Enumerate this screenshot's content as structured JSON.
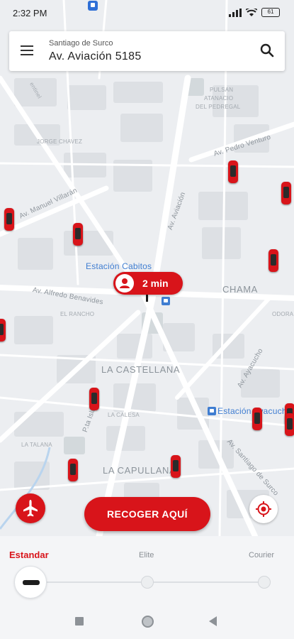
{
  "status_bar": {
    "time": "2:32 PM",
    "battery": "61"
  },
  "search": {
    "district": "Santiago de Surco",
    "address": "Av. Aviación 5185"
  },
  "map": {
    "labels": {
      "jorge_chavez": "JORGE CHAVEZ",
      "sentinel": "entinel",
      "pulsan": "PULSAN",
      "atanacio": "ATANACIO",
      "pedregal": "DEL PEDREGAL",
      "pedro_venturo": "Av. Pedro Venturo",
      "manuel_villaran": "Av. Manuel Villarán",
      "aviacion": "Av. Aviación",
      "estacion_cabitos": "Estación Cabitos",
      "benavides": "Av. Alfredo Benavides",
      "chama": "CHAMA",
      "el_rancho": "EL RANCHO",
      "odora": "ODORA",
      "la_castellana": "LA CASTELLANA",
      "ayacucho": "Av. Ayacucho",
      "estacion_ayacucho": "Estación Ayacucho",
      "pta_isla": "P.ta Isla",
      "la_calesa": "LA CALESA",
      "la_talana": "LA TALANA",
      "la_capullana": "LA CAPULLANA",
      "santiago_surco": "Av. Santiago de Surco"
    }
  },
  "eta": {
    "text": "2 min"
  },
  "actions": {
    "pickup_label": "RECOGER AQUÍ"
  },
  "services": {
    "standard": "Estandar",
    "elite": "Elite",
    "courier": "Courier"
  },
  "colors": {
    "accent": "#d8141a",
    "transit": "#3f7dd1"
  }
}
